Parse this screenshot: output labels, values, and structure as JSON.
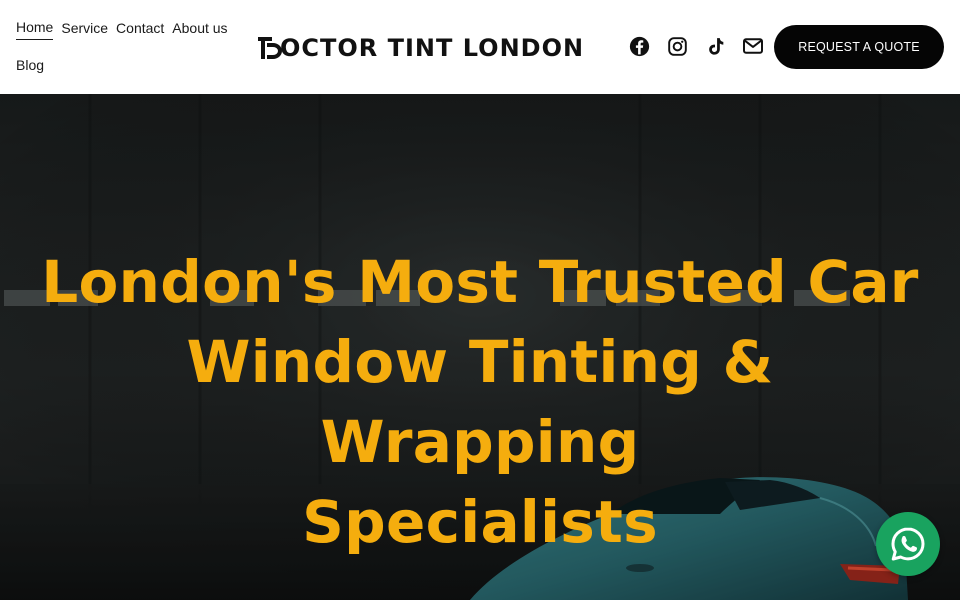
{
  "header": {
    "nav": [
      {
        "label": "Home",
        "active": true
      },
      {
        "label": "Service",
        "active": false
      },
      {
        "label": "Contact",
        "active": false
      },
      {
        "label": "About us",
        "active": false
      },
      {
        "label": "Blog",
        "active": false
      }
    ],
    "logo_text": "OCTOR TINT LONDON",
    "socials": [
      "facebook-icon",
      "instagram-icon",
      "tiktok-icon",
      "mail-icon"
    ],
    "cta_label": "REQUEST A QUOTE"
  },
  "hero": {
    "title_line1": "London's Most Trusted Car",
    "title_line2": "Window Tinting & Wrapping",
    "title_line3": "Specialists"
  },
  "colors": {
    "accent": "#f5ad0e",
    "cta_bg": "#050505",
    "whatsapp": "#19a35f"
  },
  "floating": {
    "whatsapp_icon": "whatsapp-icon"
  }
}
